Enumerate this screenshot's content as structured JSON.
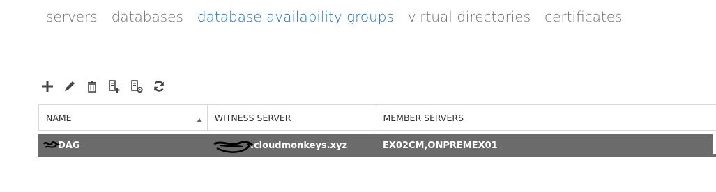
{
  "tabs": [
    {
      "label": "servers"
    },
    {
      "label": "databases"
    },
    {
      "label": "database availability groups",
      "active": true
    },
    {
      "label": "virtual directories"
    },
    {
      "label": "certificates"
    }
  ],
  "toolbar": {
    "icons": [
      "add-icon",
      "edit-icon",
      "delete-icon",
      "add-member-icon",
      "manage-member-icon",
      "refresh-icon"
    ]
  },
  "grid": {
    "columns": [
      {
        "label": "NAME",
        "sorted": "ascending"
      },
      {
        "label": "WITNESS SERVER"
      },
      {
        "label": "MEMBER SERVERS"
      }
    ],
    "rows": [
      {
        "name": "DAG",
        "witness_server": ".cloudmonkeys.xyz",
        "member_servers": "EX02CM,ONPREMEX01",
        "selected": true
      }
    ]
  },
  "colors": {
    "active_tab": "#1e73be",
    "inactive_tab": "#707070",
    "selected_row": "#6b6b6b",
    "icon": "#444444"
  }
}
